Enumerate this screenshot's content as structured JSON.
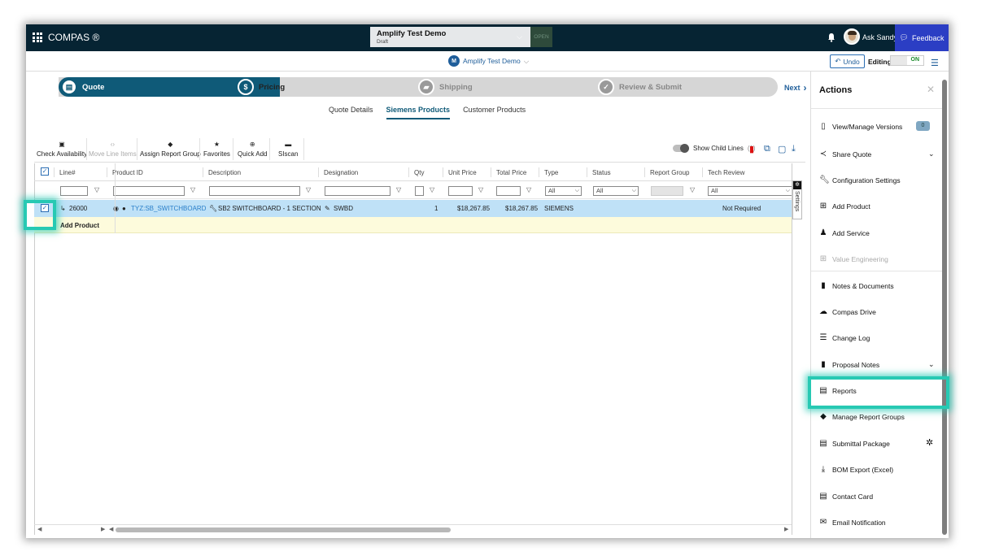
{
  "app": {
    "title": "COMPAS ®"
  },
  "project": {
    "name": "Amplify Test Demo",
    "status": "Draft",
    "badge": "OPEN"
  },
  "user": {
    "ask": "Ask Sandy",
    "feedback": "Feedback"
  },
  "breadcrumb": {
    "initial": "M",
    "name": "Amplify Test Demo"
  },
  "edit": {
    "undo": "Undo",
    "editing": "Editing",
    "toggle": "ON"
  },
  "steps": [
    {
      "label": "Quote",
      "icon": "document-icon"
    },
    {
      "label": "Pricing",
      "icon": "dollar-icon"
    },
    {
      "label": "Shipping",
      "icon": "truck-icon"
    },
    {
      "label": "Review & Submit",
      "icon": "check-icon"
    }
  ],
  "next": "Next",
  "subtabs": [
    "Quote Details",
    "Siemens Products",
    "Customer Products"
  ],
  "toolbar": {
    "check": "Check Availability",
    "move": "Move Line Items",
    "assign": "Assign Report Group",
    "favorites": "Favorites",
    "quickadd": "Quick Add",
    "siscan": "SIscan",
    "show_child": "Show Child Lines",
    "child_count": "(1)"
  },
  "columns": [
    "Line#",
    "Product ID",
    "Description",
    "Designation",
    "Qty",
    "Unit Price",
    "Total Price",
    "Type",
    "Status",
    "Report Group",
    "Tech Review"
  ],
  "filters": {
    "type": "All",
    "status": "All",
    "tech": "All"
  },
  "row": {
    "line": "26000",
    "product": "TYZ:SB_SWITCHBOARD",
    "description": "SB2 SWITCHBOARD - 1 SECTION",
    "designation": "SWBD",
    "qty": "1",
    "unit_price": "$18,267.85",
    "total_price": "$18,267.85",
    "type": "SIEMENS",
    "tech_review": "Not Required"
  },
  "add_product": "Add Product",
  "settings_tab": "Settings",
  "actions": {
    "title": "Actions",
    "items": [
      "View/Manage Versions",
      "Share Quote",
      "Configuration Settings",
      "Add Product",
      "Add Service",
      "Value Engineering",
      "Notes & Documents",
      "Compas Drive",
      "Change Log",
      "Proposal Notes",
      "Reports",
      "Manage Report Groups",
      "Submittal Package",
      "BOM Export (Excel)",
      "Contact Card",
      "Email Notification"
    ],
    "versions_count": "0"
  },
  "colors": {
    "navy": "#062433",
    "accent": "#0f5a78",
    "feedback": "#2b3ec4",
    "highlight": "#27c9b3",
    "row": "#bfe1f7"
  }
}
